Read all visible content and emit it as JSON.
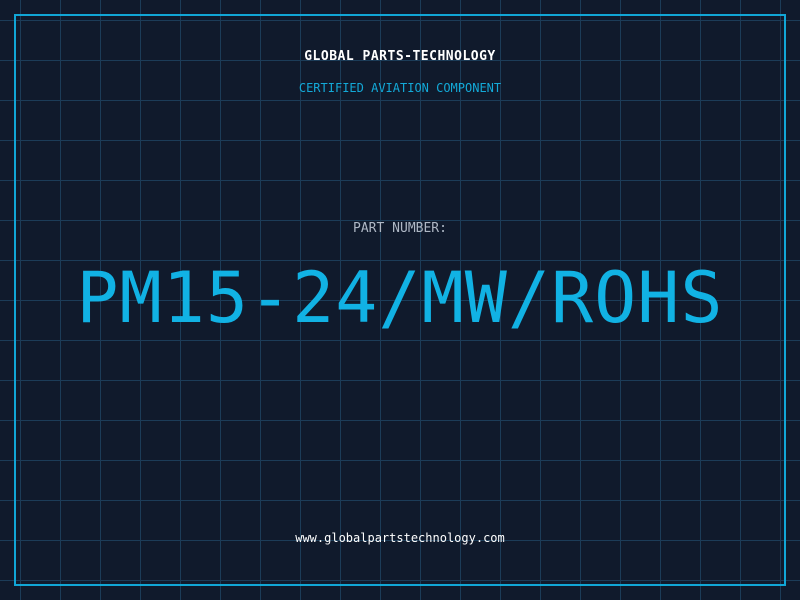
{
  "header": {
    "company": "GLOBAL PARTS-TECHNOLOGY",
    "tagline": "CERTIFIED AVIATION COMPONENT"
  },
  "part": {
    "label": "PART NUMBER:",
    "number": "PM15-24/MW/ROHS"
  },
  "footer": {
    "website": "www.globalpartstechnology.com"
  },
  "colors": {
    "background": "#101a2c",
    "grid": "#1c3c58",
    "accent": "#11b2e4",
    "text": "#ffffff",
    "muted": "#aeb7c4"
  }
}
